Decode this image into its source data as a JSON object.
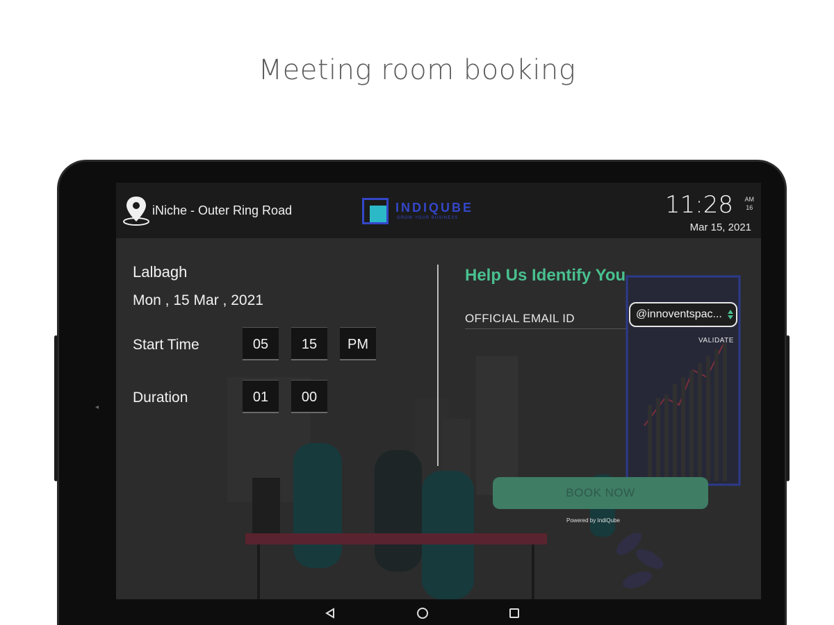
{
  "caption": "Meeting room booking",
  "header": {
    "location": "iNiche - Outer Ring Road",
    "logo_name": "INDIQUBE",
    "logo_tagline": "GROW YOUR BUSINESS",
    "time": "11:28",
    "am": "AM",
    "tz": "16",
    "date": "Mar 15, 2021"
  },
  "booking": {
    "room": "Lalbagh",
    "date": "Mon , 15 Mar , 2021",
    "start_label": "Start Time",
    "start_hour": "05",
    "start_minute": "15",
    "start_ampm": "PM",
    "duration_label": "Duration",
    "duration_hours": "01",
    "duration_minutes": "00"
  },
  "identify": {
    "title": "Help Us Identify You",
    "email_label": "OFFICIAL EMAIL ID",
    "domain_value": "@innoventspac...",
    "validate_label": "VALIDATE",
    "book_label": "BOOK NOW",
    "powered_by": "Powered by IndiQube"
  },
  "colors": {
    "accent_green": "#49c08f",
    "button_green": "#3f7d65",
    "logo_blue": "#3447c9",
    "logo_teal": "#2bb9c7"
  },
  "icons": {
    "location": "location-pin-icon",
    "nav_back": "back-triangle-icon",
    "nav_home": "home-circle-icon",
    "nav_recent": "recent-square-icon",
    "select_arrows": "select-arrows-icon"
  }
}
